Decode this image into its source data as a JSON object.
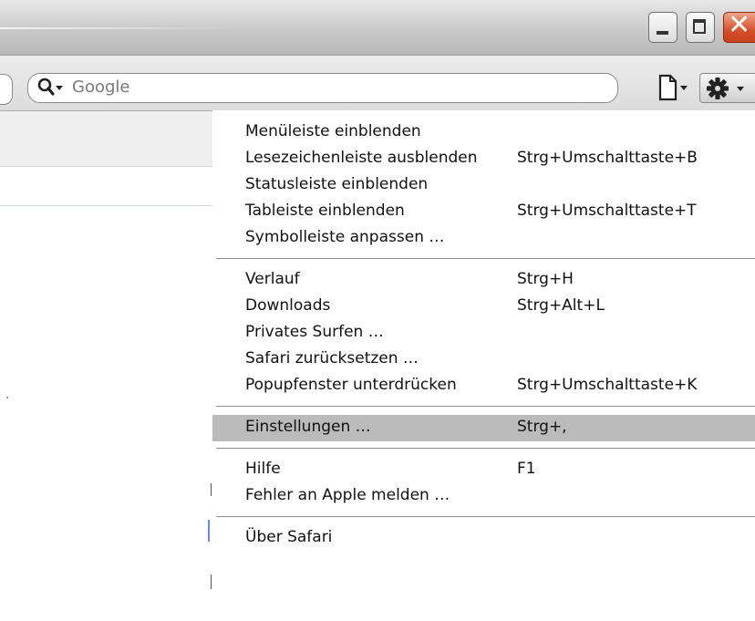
{
  "window": {
    "minimize_icon": "minimize-icon",
    "maximize_icon": "maximize-icon",
    "close_icon": "close-icon",
    "close_glyph": "✕",
    "close_color": "#d7502b"
  },
  "toolbar": {
    "search_placeholder": "Google",
    "search_icon": "search-icon",
    "page_icon": "page-menu-icon",
    "gear_icon": "gear-menu-icon"
  },
  "menu": {
    "highlight_color": "#bbbbbb",
    "groups": [
      [
        {
          "label": "Menüleiste einblenden",
          "shortcut": ""
        },
        {
          "label": "Lesezeichenleiste ausblenden",
          "shortcut": "Strg+Umschalttaste+B"
        },
        {
          "label": "Statusleiste einblenden",
          "shortcut": ""
        },
        {
          "label": "Tableiste einblenden",
          "shortcut": "Strg+Umschalttaste+T"
        },
        {
          "label": "Symbolleiste anpassen …",
          "shortcut": ""
        }
      ],
      [
        {
          "label": "Verlauf",
          "shortcut": "Strg+H"
        },
        {
          "label": "Downloads",
          "shortcut": "Strg+Alt+L"
        },
        {
          "label": "Privates Surfen …",
          "shortcut": ""
        },
        {
          "label": "Safari zurücksetzen …",
          "shortcut": ""
        },
        {
          "label": "Popupfenster unterdrücken",
          "shortcut": "Strg+Umschalttaste+K"
        }
      ],
      [
        {
          "label": "Einstellungen …",
          "shortcut": "Strg+,",
          "highlighted": true
        }
      ],
      [
        {
          "label": "Hilfe",
          "shortcut": "F1"
        },
        {
          "label": "Fehler an Apple melden …",
          "shortcut": ""
        }
      ],
      [
        {
          "label": "Über Safari",
          "shortcut": ""
        }
      ]
    ]
  }
}
